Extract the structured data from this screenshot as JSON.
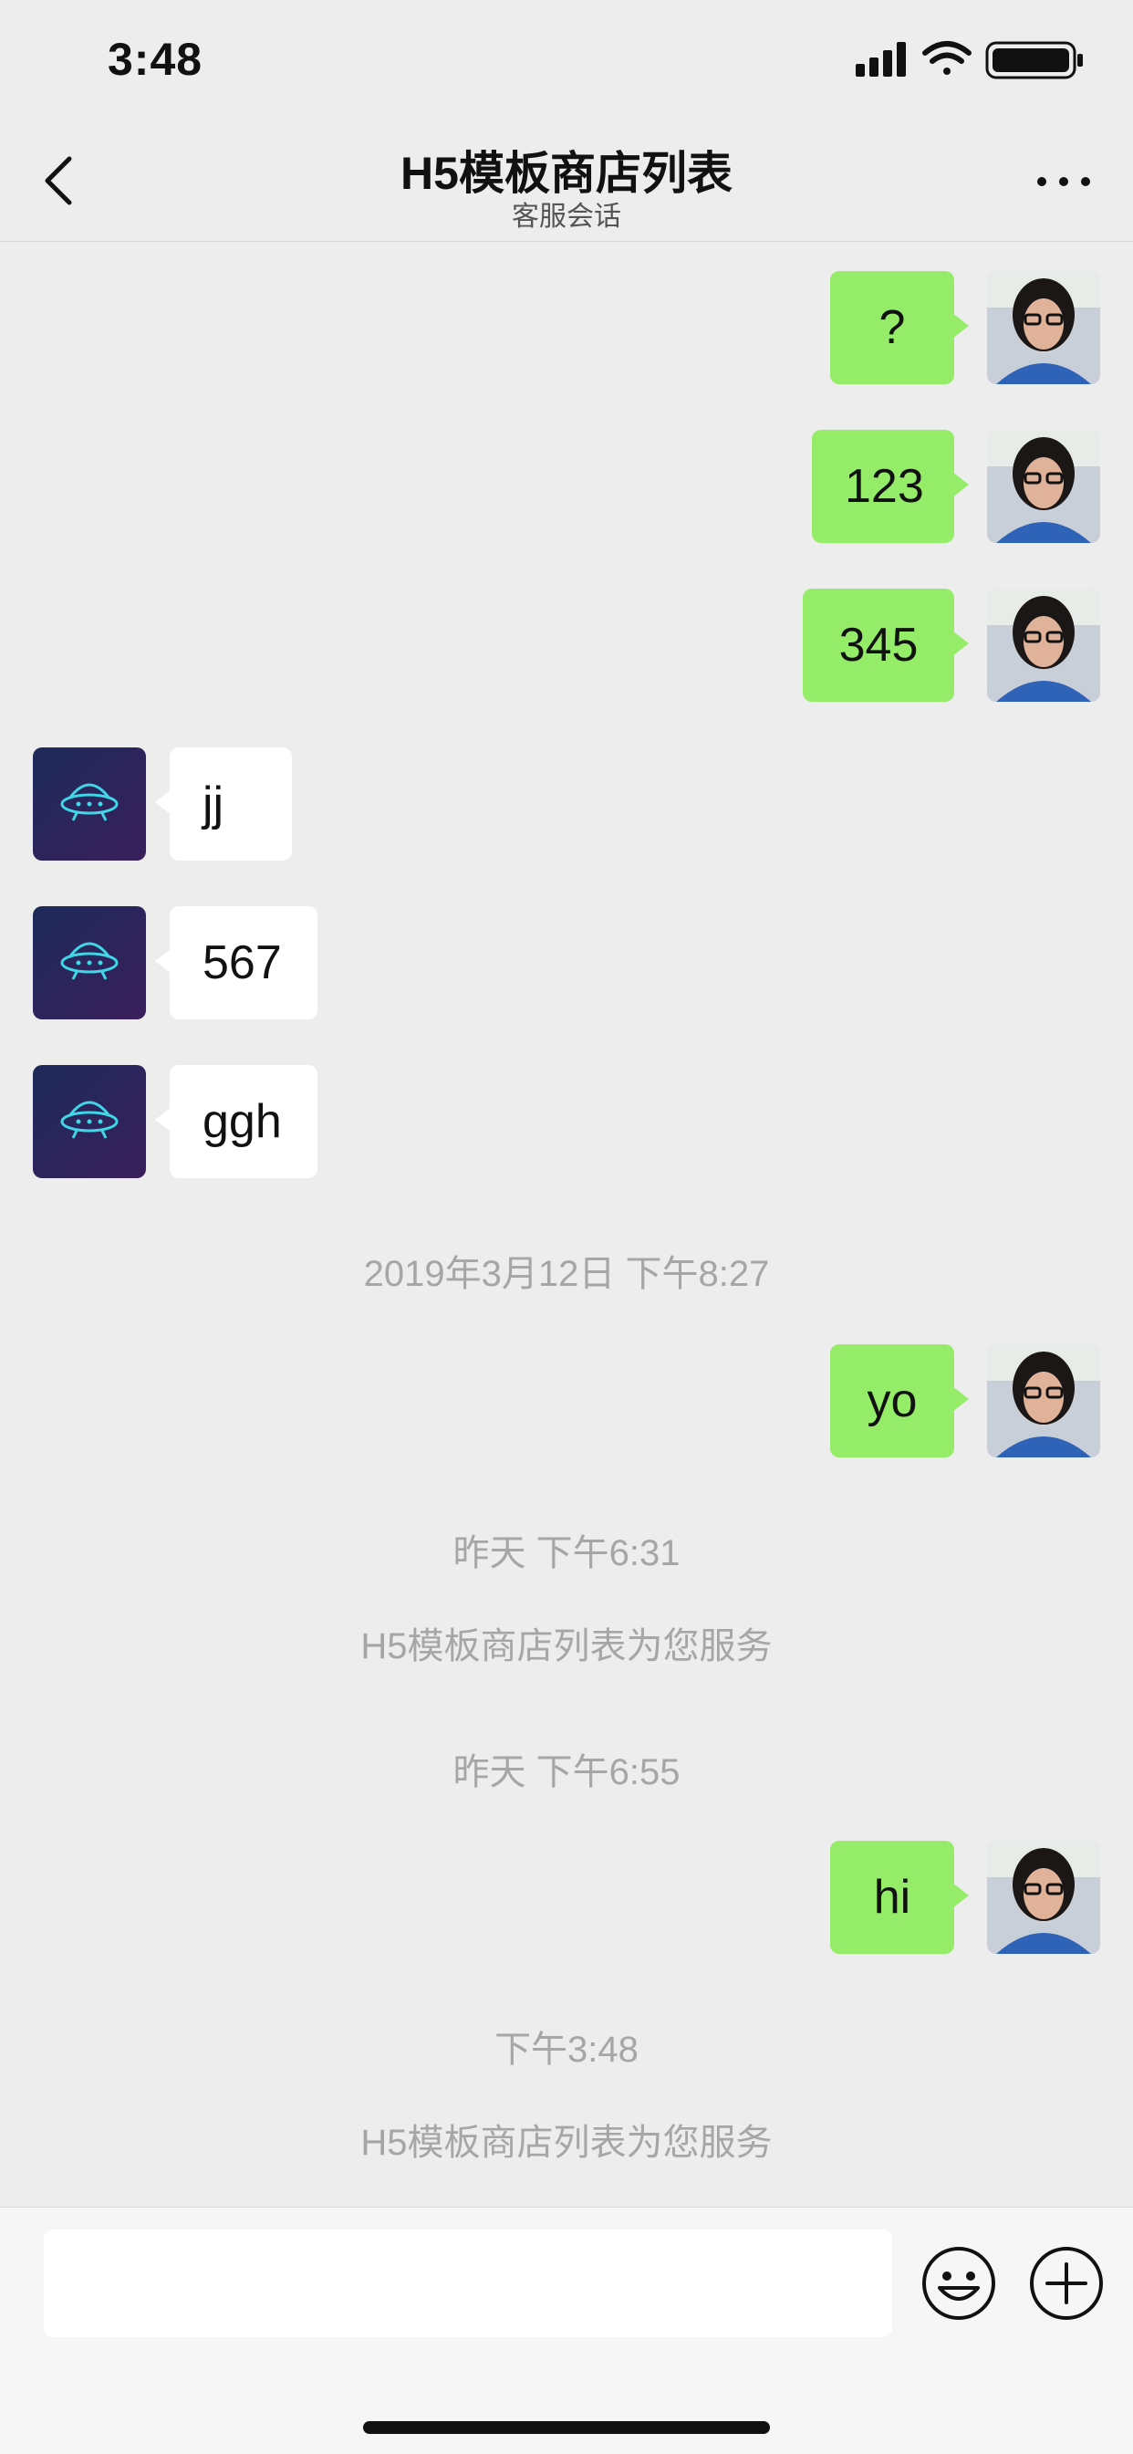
{
  "status_bar": {
    "time": "3:48"
  },
  "nav": {
    "title": "H5模板商店列表",
    "subtitle": "客服会话"
  },
  "messages": [
    {
      "side": "out",
      "text": "?"
    },
    {
      "side": "out",
      "text": "123"
    },
    {
      "side": "out",
      "text": "345"
    },
    {
      "side": "in",
      "text": "jj"
    },
    {
      "side": "in",
      "text": "567"
    },
    {
      "side": "in",
      "text": "ggh"
    },
    {
      "side": "out",
      "text": "yo"
    },
    {
      "side": "out",
      "text": "hi"
    }
  ],
  "system": {
    "time_1": "2019年3月12日 下午8:27",
    "time_2": "昨天 下午6:31",
    "service_1": "H5模板商店列表为您服务",
    "time_3": "昨天 下午6:55",
    "time_4": "下午3:48",
    "service_2": "H5模板商店列表为您服务"
  },
  "input": {
    "placeholder": ""
  },
  "colors": {
    "outgoing_bubble": "#95ec69",
    "incoming_bubble": "#ffffff",
    "background": "#ededed"
  },
  "icons": [
    "back-chevron-icon",
    "more-icon",
    "emoji-icon",
    "plus-icon",
    "signal-icon",
    "wifi-icon",
    "battery-icon"
  ]
}
